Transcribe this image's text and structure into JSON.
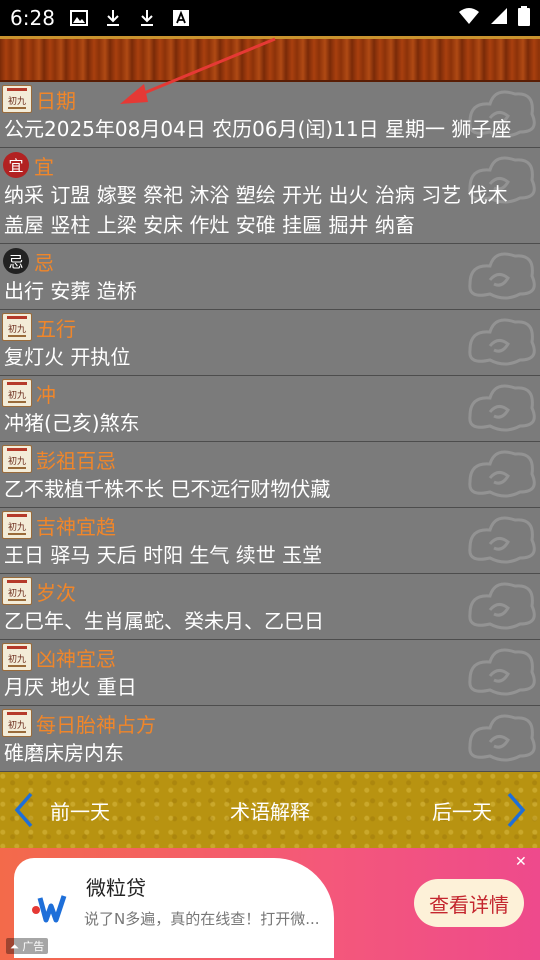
{
  "status_bar": {
    "time": "6:28",
    "icons": [
      "image-icon",
      "download-icon",
      "download-icon",
      "font-icon"
    ],
    "right_icons": [
      "wifi-icon",
      "signal-icon",
      "battery-icon"
    ]
  },
  "rows": [
    {
      "icon": "calendar-icon",
      "title": "日期",
      "lines": [
        "公元2025年08月04日 农历06月(闰)11日   星期一   狮子座"
      ]
    },
    {
      "icon": "yi-icon",
      "icon_char": "宜",
      "title": "宜",
      "lines": [
        "纳采 订盟 嫁娶 祭祀 沐浴 塑绘 开光 出火 治病 习艺 伐木",
        "盖屋 竖柱 上梁 安床 作灶 安碓   挂匾 掘井 纳畜"
      ]
    },
    {
      "icon": "ji-icon",
      "icon_char": "忌",
      "title": "忌",
      "lines": [
        "出行 安葬 造桥"
      ]
    },
    {
      "icon": "calendar-icon",
      "title": "五行",
      "lines": [
        "复灯火 开执位"
      ]
    },
    {
      "icon": "calendar-icon",
      "title": "冲",
      "lines": [
        "冲猪(己亥)煞东"
      ]
    },
    {
      "icon": "calendar-icon",
      "title": "彭祖百忌",
      "lines": [
        "乙不栽植千株不长 巳不远行财物伏藏"
      ]
    },
    {
      "icon": "calendar-icon",
      "title": "吉神宜趋",
      "lines": [
        "王日 驿马 天后 时阳 生气 续世 玉堂"
      ]
    },
    {
      "icon": "calendar-icon",
      "title": "岁次",
      "lines": [
        "乙巳年、生肖属蛇、癸未月、乙巳日"
      ]
    },
    {
      "icon": "calendar-icon",
      "title": "凶神宜忌",
      "lines": [
        "月厌 地火 重日"
      ]
    },
    {
      "icon": "calendar-icon",
      "title": "每日胎神占方",
      "lines": [
        "碓磨床房内东"
      ]
    }
  ],
  "calendar_icon_text": "初九",
  "nav": {
    "prev_label": "前一天",
    "terms_label": "术语解释",
    "next_label": "后一天"
  },
  "ad": {
    "title": "微粒贷",
    "description": "说了N多遍，真的在线查！打开微...",
    "cta_label": "查看详情",
    "badge": "广告"
  },
  "colors": {
    "title_orange": "#f0862a",
    "background_gray": "#7b7b7b",
    "nav_gold": "#b89311",
    "arrow_red": "#e53935",
    "nav_arrow_blue": "#1e6fd9"
  }
}
